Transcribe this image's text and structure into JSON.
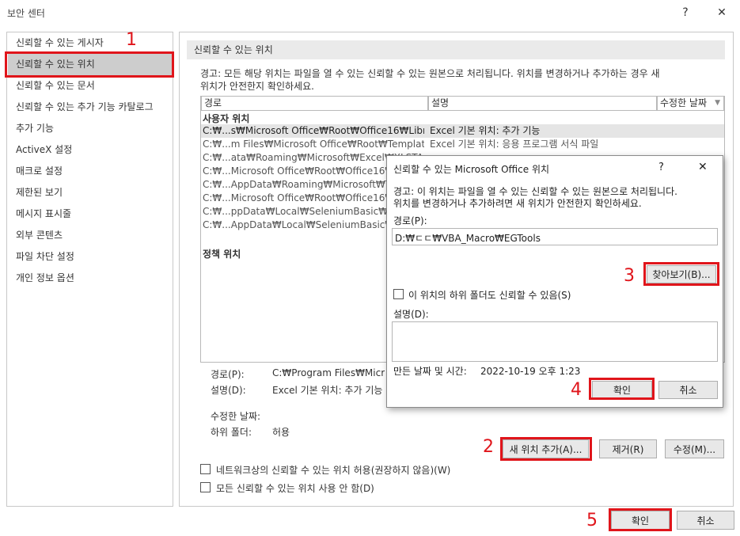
{
  "window": {
    "title": "보안 센터",
    "help_glyph": "?",
    "close_glyph": "✕"
  },
  "nav": {
    "items": [
      {
        "label": "신뢰할 수 있는 게시자"
      },
      {
        "label": "신뢰할 수 있는 위치"
      },
      {
        "label": "신뢰할 수 있는 문서"
      },
      {
        "label": "신뢰할 수 있는 추가 기능 카탈로그"
      },
      {
        "label": "추가 기능"
      },
      {
        "label": "ActiveX 설정"
      },
      {
        "label": "매크로 설정"
      },
      {
        "label": "제한된 보기"
      },
      {
        "label": "메시지 표시줄"
      },
      {
        "label": "외부 콘텐츠"
      },
      {
        "label": "파일 차단 설정"
      },
      {
        "label": "개인 정보 옵션"
      }
    ],
    "selected_index": 1
  },
  "main": {
    "section_title": "신뢰할 수 있는 위치",
    "warning_line1": "경고: 모든 해당 위치는 파일을 열 수 있는 신뢰할 수 있는 원본으로 처리됩니다. 위치를 변경하거나 추가하는 경우 새",
    "warning_line2": "위치가 안전한지 확인하세요.",
    "columns": {
      "path": "경로",
      "desc": "설명",
      "date": "수정한 날짜"
    },
    "sort_arrow": "▼",
    "user_group": "사용자 위치",
    "policy_group": "정책 위치",
    "rows": [
      {
        "path": "C:₩...s₩Microsoft Office₩Root₩Office16₩Library₩",
        "desc": "Excel 기본 위치: 추가 기능"
      },
      {
        "path": "C:₩...m Files₩Microsoft Office₩Root₩Templates₩",
        "desc": "Excel 기본 위치: 응용 프로그램 서식 파일"
      },
      {
        "path": "C:₩...ata₩Roaming₩Microsoft₩Excel₩XLSTART₩",
        "desc": ""
      },
      {
        "path": "C:₩...Microsoft Office₩Root₩Office16₩XLSTART₩",
        "desc": ""
      },
      {
        "path": "C:₩...AppData₩Roaming₩Microsoft₩Templates₩",
        "desc": ""
      },
      {
        "path": "C:₩...Microsoft Office₩Root₩Office16₩STARTUP₩",
        "desc": ""
      },
      {
        "path": "C:₩...ppData₩Local₩SeleniumBasic₩Templates₩",
        "desc": ""
      },
      {
        "path": "C:₩...AppData₩Local₩SeleniumBasic₩Examples₩",
        "desc": ""
      }
    ],
    "details": {
      "path_label": "경로(P):",
      "path_value": "C:₩Program Files₩Microsoft Office₩Root₩Office16₩Library₩",
      "desc_label": "설명(D):",
      "desc_value": "Excel 기본 위치: 추가 기능",
      "date_label": "수정한 날짜:",
      "sub_label": "하위 폴더:",
      "sub_value": "허용"
    },
    "buttons": {
      "add": "새 위치 추가(A)...",
      "remove": "제거(R)",
      "modify": "수정(M)..."
    },
    "checkbox_network": "네트워크상의 신뢰할 수 있는 위치 허용(권장하지 않음)(W)",
    "checkbox_disable_all": "모든 신뢰할 수 있는 위치 사용 안 함(D)"
  },
  "footer": {
    "ok": "확인",
    "cancel": "취소"
  },
  "dialog": {
    "title": "신뢰할 수 있는 Microsoft Office 위치",
    "help_glyph": "?",
    "close_glyph": "✕",
    "warning_line1": "경고: 이 위치는 파일을 열 수 있는 신뢰할 수 있는 원본으로 처리됩니다.",
    "warning_line2": "위치를 변경하거나 추가하려면 새 위치가 안전한지 확인하세요.",
    "path_label": "경로(P):",
    "path_value": "D:₩ㄷㄷ₩VBA_Macro₩EGTools",
    "browse": "찾아보기(B)...",
    "subfolder_checkbox": "이 위치의 하위 폴더도 신뢰할 수 있음(S)",
    "desc_label": "설명(D):",
    "desc_value": "",
    "date_label": "만든 날짜 및 시간:",
    "date_value": "2022-10-19 오후 1:23",
    "ok": "확인",
    "cancel": "취소"
  },
  "annotations": {
    "step1": "1",
    "step2": "2",
    "step3": "3",
    "step4": "4",
    "step5": "5",
    "color": "#e0151b"
  }
}
